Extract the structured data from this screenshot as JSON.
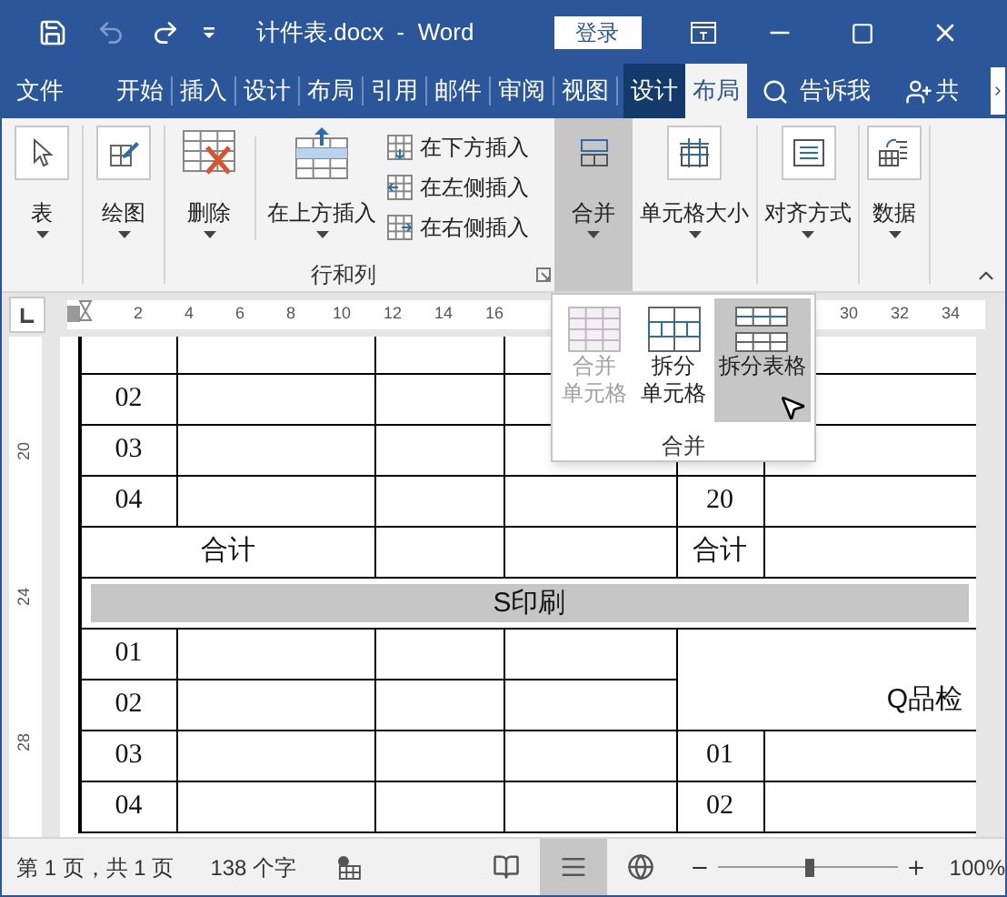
{
  "title_bar": {
    "undo": {
      "disabled": true
    },
    "title": "计件表.docx  -  Word",
    "login": "登录"
  },
  "tabs": [
    {
      "label": "文件",
      "selected": false,
      "contextual": false
    },
    {
      "label": "开始",
      "selected": false,
      "contextual": false
    },
    {
      "label": "插入",
      "selected": false,
      "contextual": false
    },
    {
      "label": "设计",
      "selected": false,
      "contextual": false
    },
    {
      "label": "布局",
      "selected": false,
      "contextual": false
    },
    {
      "label": "引用",
      "selected": false,
      "contextual": false
    },
    {
      "label": "邮件",
      "selected": false,
      "contextual": false
    },
    {
      "label": "审阅",
      "selected": false,
      "contextual": false
    },
    {
      "label": "视图",
      "selected": false,
      "contextual": false
    },
    {
      "label": "设计",
      "selected": false,
      "contextual": true
    },
    {
      "label": "布局",
      "selected": true,
      "contextual": true
    }
  ],
  "tell_me": "告诉我",
  "share": "共",
  "ribbon": {
    "select": "表",
    "draw": "绘图",
    "delete": "删除",
    "insert_above": "在上方插入",
    "insert_below": "在下方插入",
    "insert_left": "在左侧插入",
    "insert_right": "在右侧插入",
    "rows_columns_label": "行和列",
    "merge": {
      "label": "合并",
      "selected": true
    },
    "cell_size": "单元格大小",
    "alignment": "对齐方式",
    "data": "数据"
  },
  "ruler": {
    "left_numbers": [
      "2",
      "4",
      "6",
      "8",
      "10",
      "12",
      "14",
      "16"
    ],
    "right_numbers": [
      "30",
      "32",
      "34"
    ],
    "vertical_numbers": [
      "20",
      "24",
      "28"
    ]
  },
  "merge_menu": {
    "items": [
      {
        "kind": "merge_cells",
        "lines": [
          "合并",
          "单元格"
        ],
        "disabled": true,
        "selected": false
      },
      {
        "kind": "split_cells",
        "lines": [
          "拆分",
          "单元格"
        ],
        "disabled": false,
        "selected": false
      },
      {
        "kind": "split_table",
        "lines": [
          "拆分表格"
        ],
        "disabled": false,
        "selected": true
      }
    ],
    "label": "合并"
  },
  "table": {
    "rows": [
      {
        "kind": "partial"
      },
      {
        "kind": "item",
        "no": "02"
      },
      {
        "kind": "item",
        "no": "03"
      },
      {
        "kind": "item",
        "no": "04",
        "col5": "20"
      },
      {
        "kind": "total",
        "label": "合计",
        "col5": "合计"
      },
      {
        "kind": "section",
        "label": "S印刷"
      },
      {
        "kind": "merged_top",
        "no": "01",
        "merged": "Q品检"
      },
      {
        "kind": "merged_bottom",
        "no": "02"
      },
      {
        "kind": "item",
        "no": "03",
        "col5": "01"
      },
      {
        "kind": "item",
        "no": "04",
        "col5": "02"
      }
    ]
  },
  "status_bar": {
    "page": "第 1 页，共 1 页",
    "words": "138 个字",
    "views": [
      {
        "kind": "read",
        "selected": false
      },
      {
        "kind": "print",
        "selected": true
      },
      {
        "kind": "web",
        "selected": false
      }
    ],
    "zoom": {
      "level": 0.5,
      "reading": "100%"
    }
  }
}
